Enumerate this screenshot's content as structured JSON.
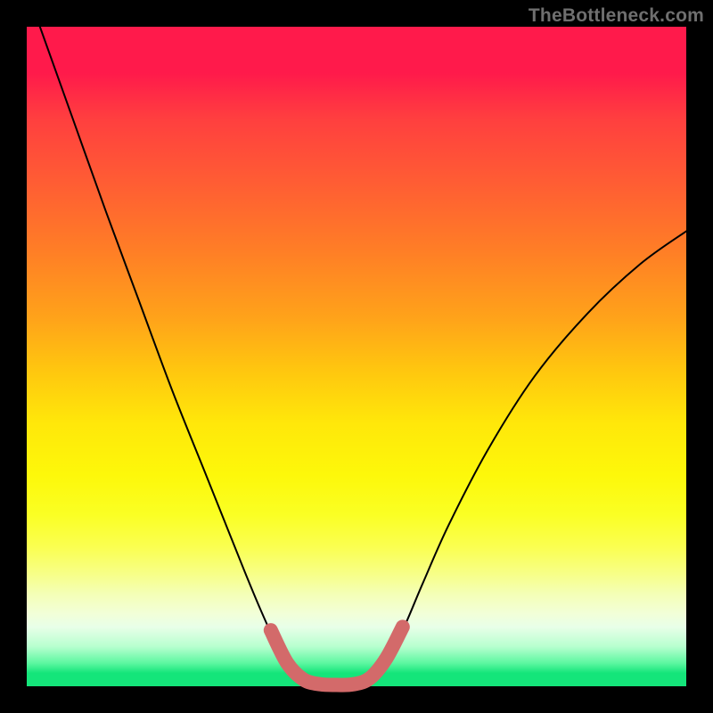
{
  "watermark": "TheBottleneck.com",
  "chart_data": {
    "type": "line",
    "title": "",
    "xlabel": "",
    "ylabel": "",
    "xlim": [
      0,
      1
    ],
    "ylim": [
      0,
      1
    ],
    "axes_visible": false,
    "background_gradient": "red-to-green vertical",
    "series": [
      {
        "name": "curve",
        "color": "#000000",
        "stroke_width": 2,
        "x": [
          0.02,
          0.07,
          0.12,
          0.17,
          0.22,
          0.27,
          0.3,
          0.33,
          0.355,
          0.38,
          0.4,
          0.42,
          0.46,
          0.5,
          0.52,
          0.54,
          0.57,
          0.6,
          0.64,
          0.7,
          0.77,
          0.85,
          0.93,
          1.0
        ],
        "y": [
          1.0,
          0.86,
          0.72,
          0.585,
          0.45,
          0.325,
          0.25,
          0.175,
          0.115,
          0.06,
          0.025,
          0.01,
          0.002,
          0.002,
          0.01,
          0.03,
          0.085,
          0.155,
          0.245,
          0.36,
          0.47,
          0.565,
          0.64,
          0.69
        ]
      },
      {
        "name": "highlight-band",
        "color": "#d36a6a",
        "stroke_width": 16,
        "x": [
          0.37,
          0.395,
          0.42,
          0.445,
          0.47,
          0.495,
          0.52,
          0.545,
          0.57
        ],
        "y": [
          0.085,
          0.035,
          0.01,
          0.003,
          0.002,
          0.003,
          0.012,
          0.042,
          0.09
        ]
      }
    ]
  }
}
